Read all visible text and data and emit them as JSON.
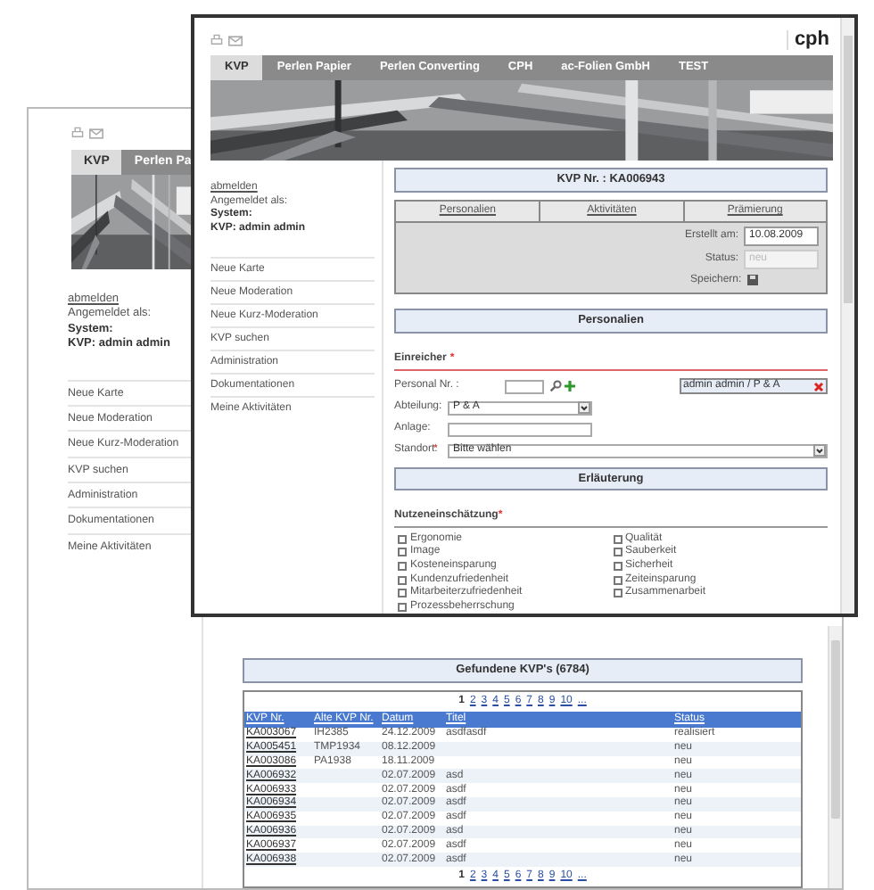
{
  "back_window": {
    "tabs": [
      {
        "label": "KVP",
        "selected": true
      },
      {
        "label": "Perlen Pa",
        "selected": false
      }
    ],
    "user_panel": {
      "logout_link": "abmelden",
      "logged_in_label": "Angemeldet als:",
      "system_label": "System:",
      "user": "KVP: admin admin"
    },
    "menu": [
      "Neue Karte",
      "Neue Moderation",
      "Neue Kurz-Moderation",
      "KVP suchen",
      "Administration",
      "Dokumentationen",
      "Meine Aktivitäten"
    ],
    "results": {
      "title": "Gefundene KVP's (6784)",
      "pages_top": [
        {
          "label": "1",
          "selected": true
        },
        {
          "label": "2",
          "selected": false
        },
        {
          "label": "3",
          "selected": false
        },
        {
          "label": "4",
          "selected": false
        },
        {
          "label": "5",
          "selected": false
        },
        {
          "label": "6",
          "selected": false
        },
        {
          "label": "7",
          "selected": false
        },
        {
          "label": "8",
          "selected": false
        },
        {
          "label": "9",
          "selected": false
        },
        {
          "label": "10",
          "selected": false
        },
        {
          "label": "...",
          "selected": false
        }
      ],
      "columns": [
        "KVP Nr.",
        "Alte KVP Nr.",
        "Datum",
        "Titel",
        "Status"
      ],
      "rows": [
        {
          "kvp_nr": "KA003067",
          "old_nr": "IH2385",
          "date": "24.12.2009",
          "title": "asdfasdf",
          "status": "realisiert"
        },
        {
          "kvp_nr": "KA005451",
          "old_nr": "TMP1934",
          "date": "08.12.2009",
          "status": "neu"
        },
        {
          "kvp_nr": "KA003086",
          "old_nr": "PA1938",
          "date": "18.11.2009",
          "status": "neu"
        },
        {
          "kvp_nr": "KA006932",
          "date": "02.07.2009",
          "title": "asd",
          "status": "neu"
        },
        {
          "kvp_nr": "KA006933",
          "date": "02.07.2009",
          "title": "asdf",
          "status": "neu"
        },
        {
          "kvp_nr": "KA006934",
          "date": "02.07.2009",
          "title": "asdf",
          "status": "neu"
        },
        {
          "kvp_nr": "KA006935",
          "date": "02.07.2009",
          "title": "asdf",
          "status": "neu"
        },
        {
          "kvp_nr": "KA006936",
          "date": "02.07.2009",
          "title": "asd",
          "status": "neu"
        },
        {
          "kvp_nr": "KA006937",
          "date": "02.07.2009",
          "title": "asdf",
          "status": "neu"
        },
        {
          "kvp_nr": "KA006938",
          "date": "02.07.2009",
          "title": "asdf",
          "status": "neu"
        }
      ],
      "pages_bottom": [
        {
          "label": "1",
          "selected": true
        },
        {
          "label": "2",
          "selected": false
        },
        {
          "label": "3",
          "selected": false
        },
        {
          "label": "4",
          "selected": false
        },
        {
          "label": "5",
          "selected": false
        },
        {
          "label": "6",
          "selected": false
        },
        {
          "label": "7",
          "selected": false
        },
        {
          "label": "8",
          "selected": false
        },
        {
          "label": "9",
          "selected": false
        },
        {
          "label": "10",
          "selected": false
        },
        {
          "label": "...",
          "selected": false
        }
      ]
    }
  },
  "front_window": {
    "logo": "cph",
    "tabs": [
      {
        "label": "KVP",
        "selected": true
      },
      {
        "label": "Perlen Papier",
        "selected": false
      },
      {
        "label": "Perlen Converting",
        "selected": false
      },
      {
        "label": "CPH",
        "selected": false
      },
      {
        "label": "ac-Folien GmbH",
        "selected": false
      },
      {
        "label": "TEST",
        "selected": false
      }
    ],
    "user_panel": {
      "logout_link": "abmelden",
      "logged_in_label": "Angemeldet als:",
      "system_label": "System:",
      "user": "KVP: admin admin"
    },
    "menu": [
      "Neue Karte",
      "Neue Moderation",
      "Neue Kurz-Moderation",
      "KVP suchen",
      "Administration",
      "Dokumentationen",
      "Meine Aktivitäten"
    ],
    "form": {
      "record_title": "KVP Nr. : KA006943",
      "section_links": [
        "Personalien",
        "Aktivitäten",
        "Prämierung"
      ],
      "created": {
        "label": "Erstellt am:",
        "value": "10.08.2009"
      },
      "status": {
        "label": "Status:",
        "value": "neu",
        "disabled": true
      },
      "save_label": "Speichern:",
      "personal_header": "Personalien",
      "submitter": {
        "heading": "Einreicher",
        "required_mark": "*"
      },
      "personnel": {
        "label": "Personal Nr. :",
        "selection": "admin admin / P & A"
      },
      "department": {
        "label": "Abteilung:",
        "value": "P & A"
      },
      "plant": {
        "label": "Anlage:"
      },
      "location": {
        "label": "Standort:",
        "required_mark": "*",
        "value": "Bitte wählen"
      },
      "explanation_header": "Erläuterung",
      "benefit": {
        "heading": "Nutzeneinschätzung",
        "required_mark": "*",
        "options_left": [
          {
            "label": "Ergonomie",
            "checked": false
          },
          {
            "label": "Image",
            "checked": false
          },
          {
            "label": "Kosteneinsparung",
            "checked": false
          },
          {
            "label": "Kundenzufriedenheit",
            "checked": false
          },
          {
            "label": "Mitarbeiterzufriedenheit",
            "checked": false
          },
          {
            "label": "Prozessbeherrschung",
            "checked": false
          }
        ],
        "options_right": [
          {
            "label": "Qualität",
            "checked": false
          },
          {
            "label": "Sauberkeit",
            "checked": false
          },
          {
            "label": "Sicherheit",
            "checked": false
          },
          {
            "label": "Zeiteinsparung",
            "checked": false
          },
          {
            "label": "Zusammenarbeit",
            "checked": false
          }
        ]
      }
    }
  }
}
